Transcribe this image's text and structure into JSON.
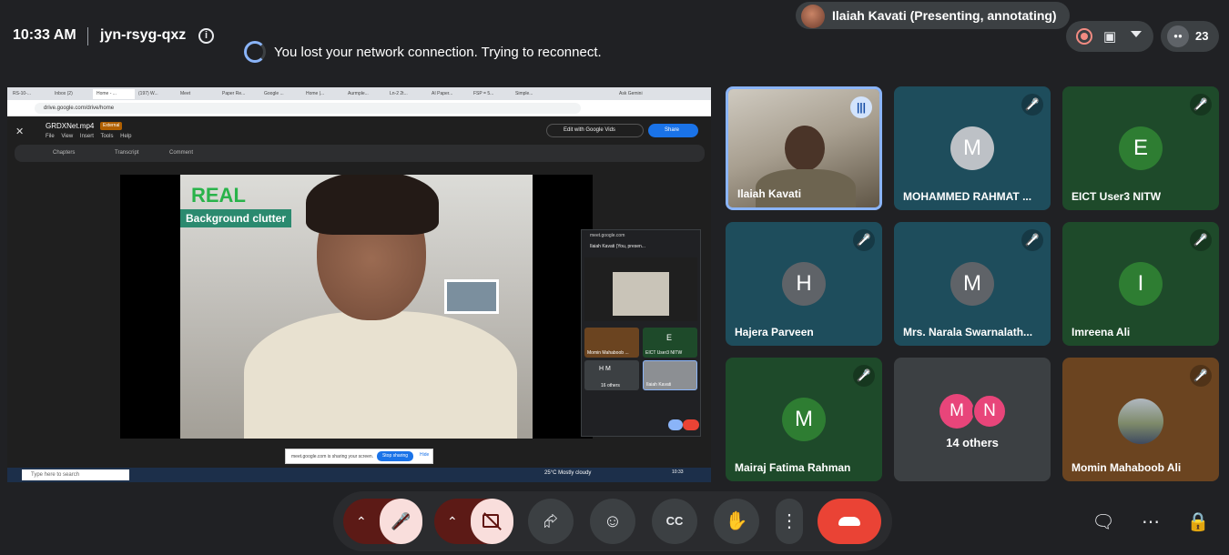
{
  "header": {
    "time": "10:33 AM",
    "meeting_code": "jyn-rsyg-qxz",
    "presenter_chip": "Ilaiah Kavati (Presenting, annotating)",
    "network_banner": "You lost your network connection. Trying to reconnect.",
    "participant_count": "23"
  },
  "shared_screen": {
    "browser_tabs": [
      "RS-10-...",
      "Inbox (2)",
      "Home - ...",
      "(197) W...",
      "Meet",
      "Paper Re...",
      "Google ...",
      "Home |...",
      "Aurmple...",
      "Ln-2 2t...",
      "AI Paper...",
      "FSP = 5...",
      "Simple...",
      "Ask Gemini"
    ],
    "url": "drive.google.com/drive/home",
    "file_name": "GRDXNet.mp4",
    "external_badge": "External",
    "menu": "File View Insert Tools Help",
    "edit_with_vids": "Edit with Google Vids",
    "share_label": "Share",
    "toolbar_chapters": "Chapters",
    "toolbar_transcript": "Transcript",
    "toolbar_comment": "Comment",
    "video_real_label": "REAL",
    "video_clutter_label": "Background clutter",
    "pip": {
      "title": "meet.google.com",
      "presenter": "Ilaiah Kavati (You, presen...",
      "tile1": "Momin Mahaboob ...",
      "tile2_initial": "E",
      "tile2": "EICT User3 NITW",
      "tile3_initials": "H M",
      "tile3": "16 others",
      "tile4": "Ilaiah Kavati"
    },
    "stop_sharing_text": "meet.google.com is sharing your screen.",
    "stop_sharing_button": "Stop sharing",
    "hide_label": "Hide",
    "taskbar_search": "Type here to search",
    "taskbar_weather": "25°C Mostly cloudy",
    "taskbar_time": "10:33"
  },
  "participants": [
    {
      "name": "Ilaiah Kavati",
      "initial": "",
      "speaking": true
    },
    {
      "name": "MOHAMMED RAHMAT ...",
      "initial": "M",
      "muted": true
    },
    {
      "name": "EICT User3 NITW",
      "initial": "E",
      "muted": true
    },
    {
      "name": "Hajera Parveen",
      "initial": "H",
      "muted": true
    },
    {
      "name": "Mrs. Narala Swarnalath...",
      "initial": "M",
      "muted": true
    },
    {
      "name": "Imreena Ali",
      "initial": "I",
      "muted": true
    },
    {
      "name": "Mairaj Fatima Rahman",
      "initial": "M",
      "muted": true
    },
    {
      "name": "14 others",
      "initials": [
        "M",
        "N"
      ]
    },
    {
      "name": "Momin Mahaboob Ali",
      "initial": "",
      "muted": true
    }
  ],
  "colors": {
    "background": "#202124",
    "tile_teal": "#1e4d5c",
    "tile_green": "#1e4a2a",
    "tile_gray": "#3c4043",
    "tile_brown": "#6b4420",
    "end_call": "#ea4335",
    "mic_off": "#f9dedc"
  },
  "controls": {
    "mic": "mic-off",
    "camera": "camera-off",
    "present": "present-screen",
    "reactions": "emoji",
    "captions": "closed-captions",
    "raise_hand": "raise-hand",
    "more": "more-options",
    "end_call": "end-call"
  },
  "right_controls": [
    "chat",
    "activities",
    "host-controls"
  ]
}
